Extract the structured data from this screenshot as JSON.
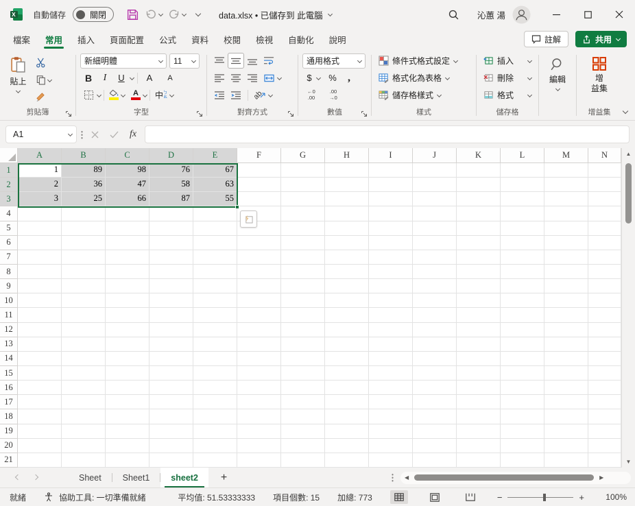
{
  "titlebar": {
    "autosave_label": "自動儲存",
    "autosave_state": "關閉",
    "doc_title": "data.xlsx • 已儲存到 此電腦",
    "user_name": "沁蕙 湯"
  },
  "ribbon_tabs": {
    "items": [
      "檔案",
      "常用",
      "插入",
      "頁面配置",
      "公式",
      "資料",
      "校閱",
      "檢視",
      "自動化",
      "說明"
    ],
    "active": "常用"
  },
  "tab_actions": {
    "comments": "註解",
    "share": "共用"
  },
  "ribbon": {
    "paste_label": "貼上",
    "clipboard_group": "剪貼簿",
    "font_name": "新細明體",
    "font_size": "11",
    "bold": "B",
    "italic": "I",
    "underline": "U",
    "grow_font": "A",
    "shrink_font": "A",
    "phonetic": "中",
    "font_group": "字型",
    "orient_ab": "ab",
    "alignment_group": "對齊方式",
    "number_format": "通用格式",
    "currency": "$",
    "percent": "%",
    "comma": ",",
    "inc_dec_top": "←0",
    "inc_dec_bottom": ".00",
    "dec_dec_top": ".00",
    "dec_dec_bottom": "→0",
    "number_group": "數值",
    "conditional_formatting": "條件式格式設定",
    "format_as_table": "格式化為表格",
    "cell_styles": "儲存格樣式",
    "styles_group": "樣式",
    "insert_label": "插入",
    "delete_label": "刪除",
    "format_label": "格式",
    "cells_group": "儲存格",
    "editing_label": "編輯",
    "addins_line1": "增",
    "addins_line2": "益集",
    "addins_group": "增益集"
  },
  "formula_bar": {
    "name_box": "A1",
    "fx": "fx",
    "formula": ""
  },
  "grid": {
    "columns": [
      "A",
      "B",
      "C",
      "D",
      "E",
      "F",
      "G",
      "H",
      "I",
      "J",
      "K",
      "L",
      "M",
      "N"
    ],
    "selected_columns": [
      "A",
      "B",
      "C",
      "D",
      "E"
    ],
    "row_count": 21,
    "selected_rows": [
      1,
      2,
      3
    ],
    "active_cell": "A1",
    "selection": "A1:E3",
    "data": [
      [
        1,
        89,
        98,
        76,
        67
      ],
      [
        2,
        36,
        47,
        58,
        63
      ],
      [
        3,
        25,
        66,
        87,
        55
      ]
    ]
  },
  "sheet_tabs": {
    "items": [
      "Sheet",
      "Sheet1",
      "sheet2"
    ],
    "active": "sheet2",
    "new_sheet": "+"
  },
  "status_bar": {
    "mode": "就緒",
    "accessibility": "協助工具: 一切準備就緒",
    "average": "平均值: 51.53333333",
    "count": "項目個數: 15",
    "sum": "加總: 773",
    "zoom_level": "100%"
  },
  "colors": {
    "excel_green": "#107C41",
    "selection_border": "#1A7340",
    "selection_fill": "#D3D3D3",
    "header_selected_text": "#217346",
    "save_icon": "#B637AB",
    "addins_icon": "#D83B01",
    "fill_color_swatch": "#FFF000",
    "font_color_swatch": "#E3000B"
  }
}
